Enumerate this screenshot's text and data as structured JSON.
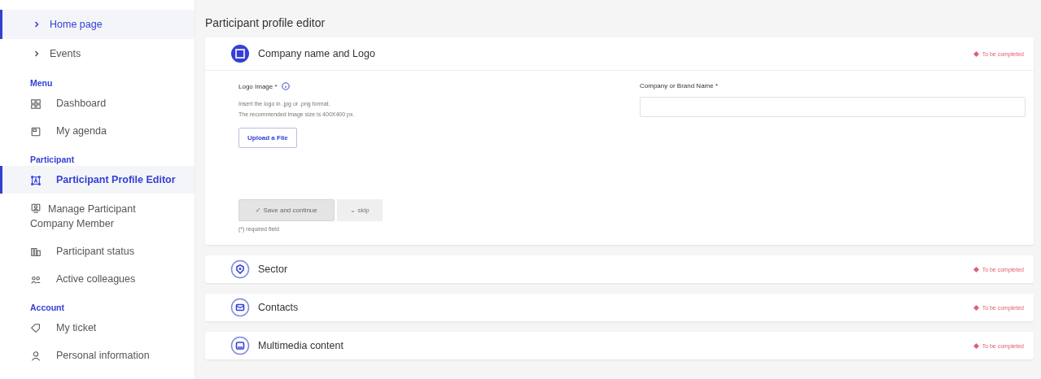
{
  "sidebar": {
    "nav": [
      {
        "label": "Home page",
        "selected": true
      },
      {
        "label": "Events",
        "selected": false
      }
    ],
    "groups": [
      {
        "title": "Menu",
        "items": [
          {
            "label": "Dashboard",
            "selected": false
          },
          {
            "label": "My agenda",
            "selected": false
          }
        ]
      },
      {
        "title": "Participant",
        "items": [
          {
            "label": "Participant Profile Editor",
            "selected": true
          },
          {
            "label": "Manage Participant Company Member",
            "selected": false
          },
          {
            "label": "Participant status",
            "selected": false
          },
          {
            "label": "Active colleagues",
            "selected": false
          }
        ]
      },
      {
        "title": "Account",
        "items": [
          {
            "label": "My ticket",
            "selected": false
          },
          {
            "label": "Personal information",
            "selected": false
          }
        ]
      }
    ]
  },
  "page_title": "Participant profile editor",
  "sections": [
    {
      "title": "Company name and Logo",
      "status": "To be completed",
      "expanded": true
    },
    {
      "title": "Sector",
      "status": "To be completed",
      "expanded": false
    },
    {
      "title": "Contacts",
      "status": "To be completed",
      "expanded": false
    },
    {
      "title": "Multimedia content",
      "status": "To be completed",
      "expanded": false
    }
  ],
  "form": {
    "logo_label": "Logo Image *",
    "logo_help": [
      "Insert the logo in .jpg or .png format.",
      "The recommended image size is 400X400 px."
    ],
    "upload_button": "Upload a File",
    "name_label": "Company or Brand Name *",
    "save_button": "✓ Save and continue",
    "skip_button": "⌄ skip",
    "required_note": "(*) required field"
  }
}
